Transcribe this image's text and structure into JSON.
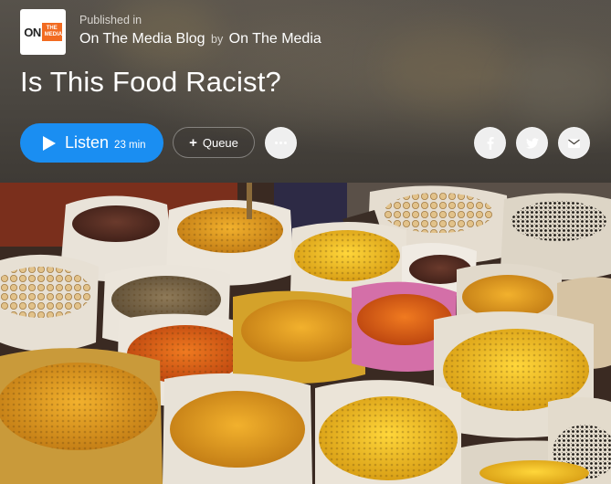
{
  "header": {
    "logo": {
      "line1": "ON",
      "line2": "THE",
      "line3": "MEDIA",
      "accent": "#f26b21"
    },
    "published_label": "Published in",
    "publication": "On The Media Blog",
    "by_label": "by",
    "author": "On The Media",
    "title": "Is This Food Racist?"
  },
  "actions": {
    "listen_label": "Listen",
    "listen_duration": "23 min",
    "listen_color": "#1a8ef2",
    "queue_label": "Queue",
    "more_icon": "ellipsis-icon",
    "share": [
      "facebook-icon",
      "twitter-icon",
      "mail-icon"
    ]
  },
  "photo": {
    "subject": "spice-sacks-image"
  }
}
